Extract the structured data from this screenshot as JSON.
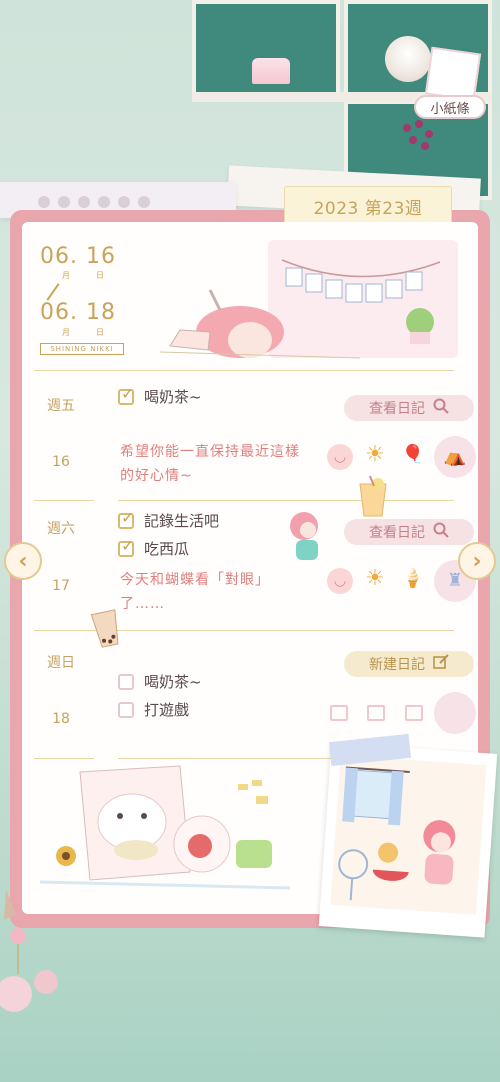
{
  "header": {
    "week_label": "2023 第23週",
    "note_tag": "小紙條"
  },
  "date_range": {
    "start_month": "06",
    "start_day": "16",
    "end_month": "06",
    "end_day": "18",
    "month_unit": "月",
    "day_unit": "日",
    "brand": "SHINING NIKKI"
  },
  "days": [
    {
      "weekday": "週五",
      "date": "16",
      "tasks": [
        {
          "label": "喝奶茶~",
          "checked": true
        }
      ],
      "note": "希望你能一直保持最近這樣的好心情~",
      "button": "查看日記"
    },
    {
      "weekday": "週六",
      "date": "17",
      "tasks": [
        {
          "label": "記錄生活吧",
          "checked": true
        },
        {
          "label": "吃西瓜",
          "checked": true
        }
      ],
      "note": "今天和蝴蝶看「對眼」了……",
      "button": "查看日記"
    },
    {
      "weekday": "週日",
      "date": "18",
      "tasks": [
        {
          "label": "喝奶茶~",
          "checked": false
        },
        {
          "label": "打遊戲",
          "checked": false
        }
      ],
      "note": "",
      "button": "新建日記"
    }
  ],
  "icons": {
    "search": "search-icon",
    "edit": "edit-icon",
    "prev": "‹",
    "next": "›"
  },
  "colors": {
    "accent_gold": "#c9a35a",
    "accent_pink": "#eaa6ad",
    "note_red": "#e0807e",
    "view_button_bg": "#f6e1e3",
    "new_button_bg": "#f5eacd"
  }
}
